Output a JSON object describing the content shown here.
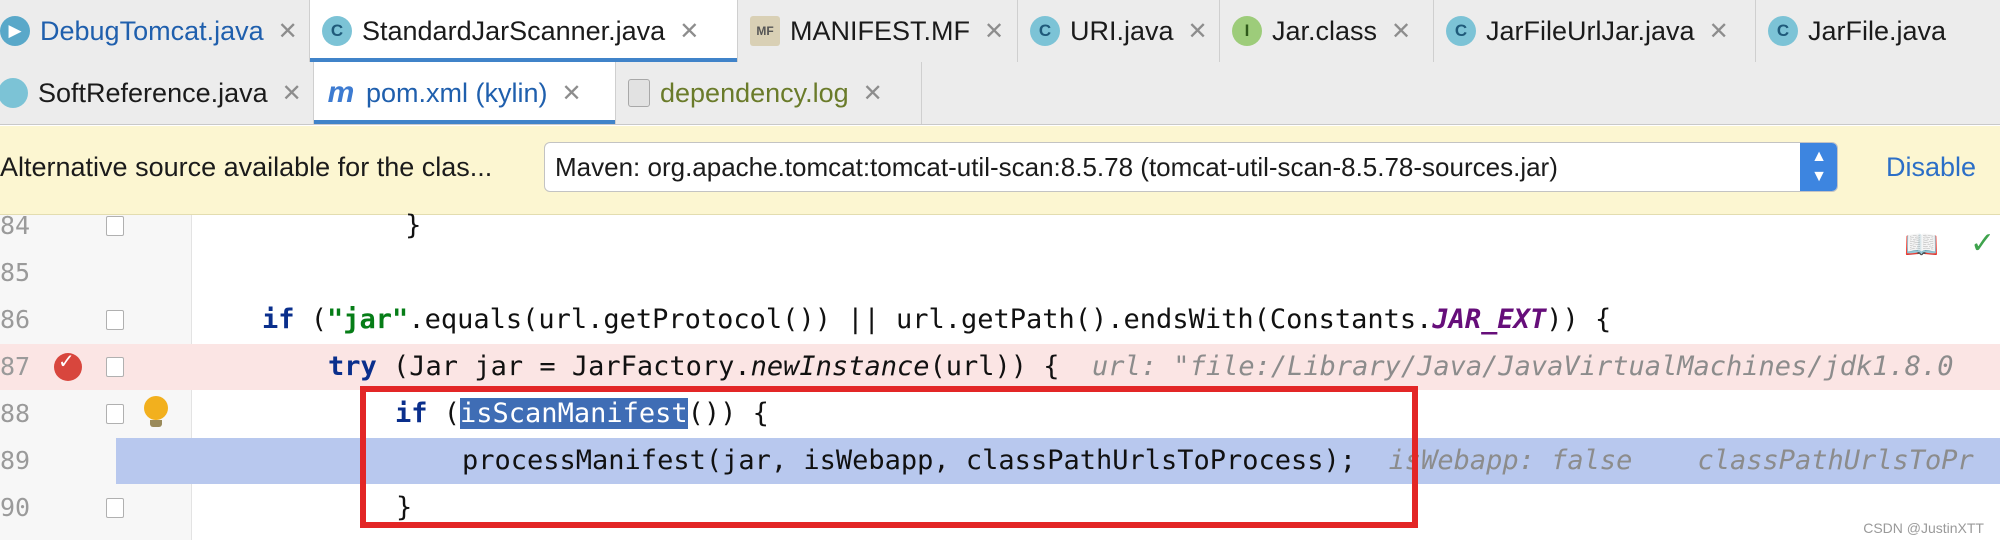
{
  "tabs_row1": [
    {
      "label": "DebugTomcat.java",
      "icon": "java-run-icon",
      "active": false
    },
    {
      "label": "StandardJarScanner.java",
      "icon": "class-icon",
      "icon_text": "C",
      "active": true
    },
    {
      "label": "MANIFEST.MF",
      "icon": "manifest-file-icon",
      "icon_text": "MF",
      "active": false
    },
    {
      "label": "URI.java",
      "icon": "class-icon",
      "icon_text": "C",
      "active": false
    },
    {
      "label": "Jar.class",
      "icon": "interface-icon",
      "icon_text": "I",
      "active": false
    },
    {
      "label": "JarFileUrlJar.java",
      "icon": "class-icon",
      "icon_text": "C",
      "active": false
    },
    {
      "label": "JarFile.java",
      "icon": "class-icon",
      "icon_text": "C",
      "active": false
    }
  ],
  "tabs_row2": [
    {
      "label": "SoftReference.java",
      "icon": "class-icon",
      "active": false
    },
    {
      "label": "pom.xml (kylin)",
      "icon": "maven-icon",
      "icon_text": "m",
      "active": true
    },
    {
      "label": "dependency.log",
      "icon": "log-file-icon",
      "active": false
    }
  ],
  "close_glyph": "✕",
  "banner": {
    "message": "Alternative source available for the clas...",
    "select_value": "Maven: org.apache.tomcat:tomcat-util-scan:8.5.78 (tomcat-util-scan-8.5.78-sources.jar)",
    "disable_label": "Disable"
  },
  "editor": {
    "lines": [
      {
        "number": "84",
        "text": "            }"
      },
      {
        "number": "85",
        "text": ""
      },
      {
        "number": "86",
        "kw1": "if",
        "str": "\"jar\"",
        "mid": ".equals(url.getProtocol()) || url.getPath().endsWith(Constants.",
        "const": "JAR_EXT",
        "end": ")) {"
      },
      {
        "number": "87",
        "kw": "try",
        "pre": " (Jar jar = JarFactory.",
        "method": "newInstance",
        "post": "(url)) {",
        "hint": "url: \"file:/Library/Java/JavaVirtualMachines/jdk1.8.0"
      },
      {
        "number": "88",
        "kw": "if",
        "pre": " (",
        "selected": "isScanManifest",
        "post": "()) {"
      },
      {
        "number": "89",
        "text": "processManifest(jar, isWebapp, classPathUrlsToProcess);",
        "hint1": "isWebapp: false",
        "hint2": "classPathUrlsToPr"
      },
      {
        "number": "90",
        "text": "}"
      }
    ],
    "breakpoint_line": "87",
    "execution_line": "89"
  },
  "watermark": "CSDN @JustinXTT",
  "colors": {
    "accent": "#4083c9",
    "breakpoint_line_bg": "#fbe5e4",
    "execution_line_bg": "#b8c8ee",
    "highlight_box": "#e32626"
  }
}
